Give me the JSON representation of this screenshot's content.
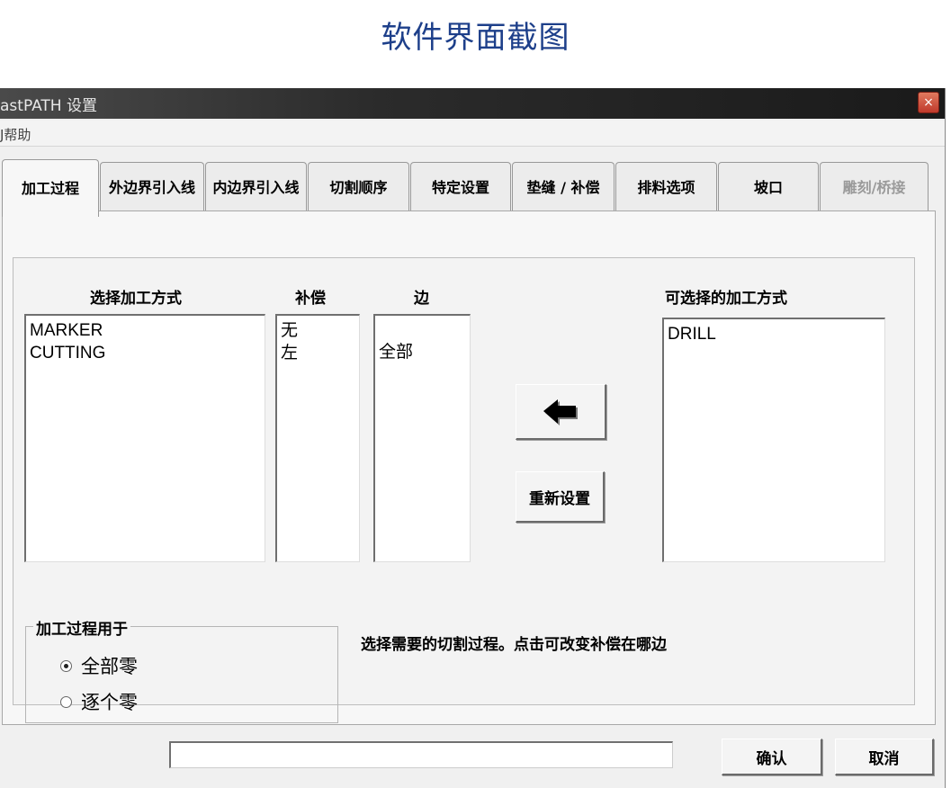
{
  "page": {
    "title": "软件界面截图"
  },
  "window": {
    "title": "astPATH 设置",
    "close_symbol": "×"
  },
  "menu": {
    "help_label": "J帮助"
  },
  "tabs": [
    {
      "label": "加工过程",
      "active": true
    },
    {
      "label": "外边界引入线"
    },
    {
      "label": "内边界引入线"
    },
    {
      "label": "切割顺序"
    },
    {
      "label": "特定设置"
    },
    {
      "label": "垫缝 / 补偿"
    },
    {
      "label": "排料选项"
    },
    {
      "label": "坡口"
    },
    {
      "label": "雕刻/桥接",
      "disabled": true
    }
  ],
  "process": {
    "select_header": "选择加工方式",
    "compensation_header": "补偿",
    "side_header": "边",
    "available_header": "可选择的加工方式",
    "selected_methods": [
      "MARKER",
      "CUTTING"
    ],
    "compensation_values": [
      "无",
      "左"
    ],
    "side_values": [
      "全部"
    ],
    "available_methods": [
      "DRILL"
    ],
    "move_left_icon": "left-arrow-icon",
    "reset_label": "重新设置",
    "applies_to_label": "加工过程用于",
    "applies_options": [
      {
        "label": "全部零",
        "selected": true
      },
      {
        "label": "逐个零",
        "selected": false
      }
    ],
    "hint": "选择需要的切割过程。点击可改变补偿在哪边"
  },
  "footer": {
    "status_value": "",
    "ok_label": "确认",
    "cancel_label": "取消"
  }
}
